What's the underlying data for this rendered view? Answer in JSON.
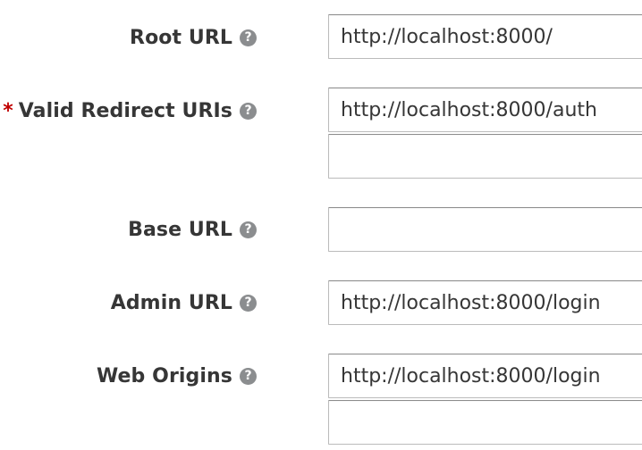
{
  "fields": {
    "root_url": {
      "label": "Root URL",
      "value": "http://localhost:8000/"
    },
    "valid_redirect_uris": {
      "required_marker": "*",
      "label": "Valid Redirect URIs",
      "values": [
        "http://localhost:8000/auth",
        ""
      ]
    },
    "base_url": {
      "label": "Base URL",
      "value": ""
    },
    "admin_url": {
      "label": "Admin URL",
      "value": "http://localhost:8000/login"
    },
    "web_origins": {
      "label": "Web Origins",
      "values": [
        "http://localhost:8000/login",
        ""
      ]
    }
  },
  "help_icon_glyph": "?",
  "icons": {
    "help": "question-circle-icon"
  },
  "colors": {
    "label": "#363636",
    "required": "#c00000",
    "help_icon_bg": "#8b8d8f",
    "input_border": "#bbbbbb"
  }
}
